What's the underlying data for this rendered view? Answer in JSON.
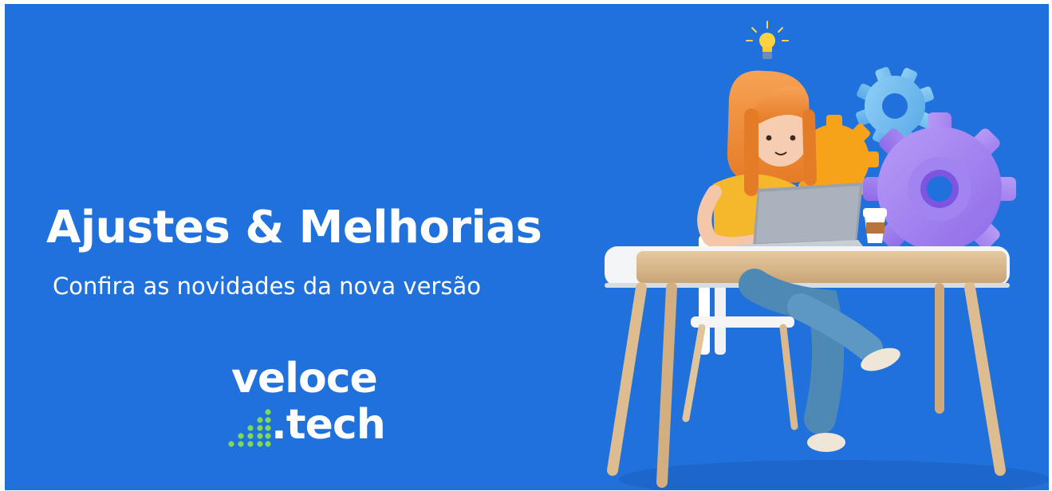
{
  "banner": {
    "headline": "Ajustes & Melhorias",
    "subheadline": "Confira as novidades da nova versão",
    "background_color": "#2071dc"
  },
  "logo": {
    "word_top": "veloce",
    "word_bottom": ".tech",
    "mark_color": "#7ed957"
  },
  "illustration": {
    "icons": [
      "lightbulb-icon",
      "gear-icon",
      "gear-icon",
      "gear-icon"
    ]
  }
}
